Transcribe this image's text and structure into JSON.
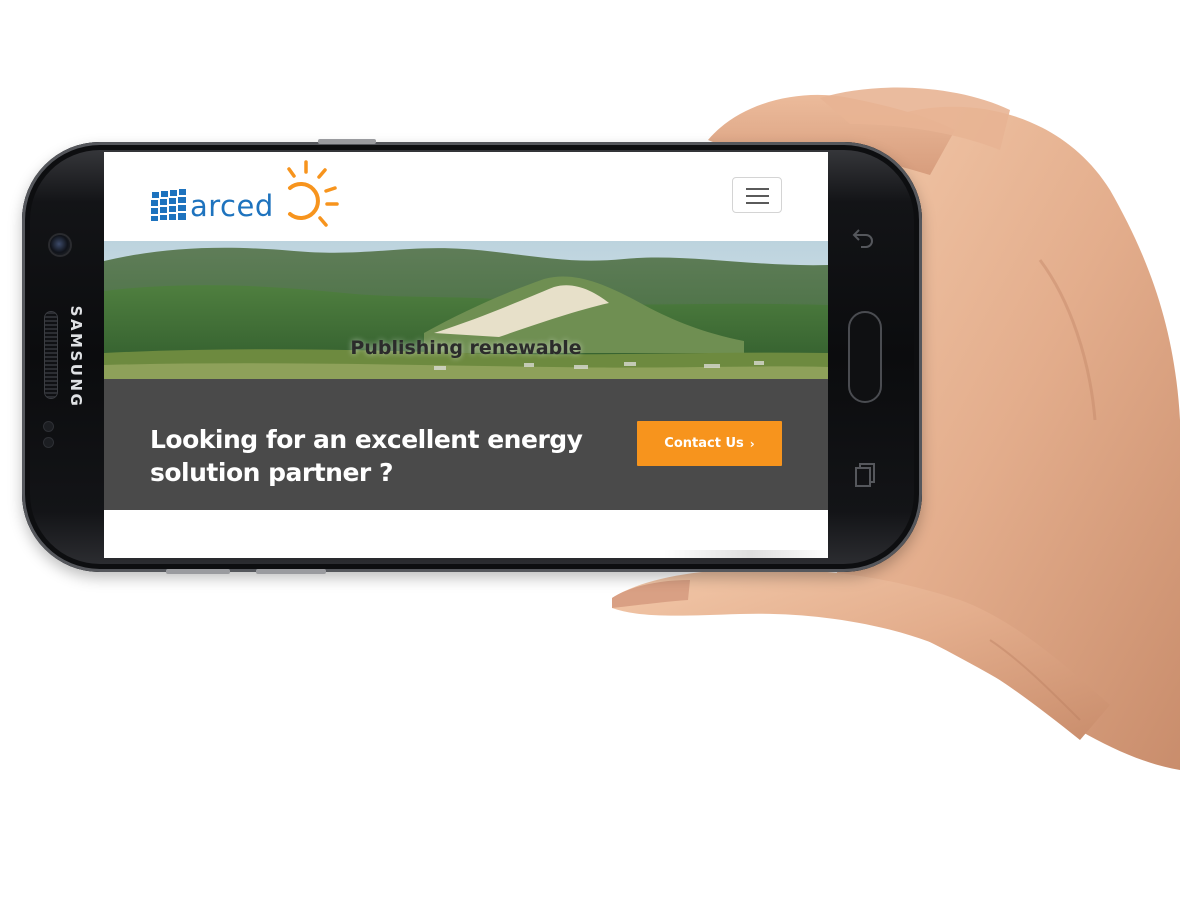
{
  "device": {
    "brand": "SAMSUNG"
  },
  "site": {
    "logo_text": "arced",
    "menu_toggle_label": "Toggle navigation"
  },
  "hero": {
    "caption": "Publishing renewable"
  },
  "cta": {
    "headline": "Looking for an excellent energy solution partner ?",
    "button_label": "Contact Us",
    "button_chevron": "›"
  },
  "colors": {
    "brand_blue": "#1e73be",
    "sun_orange": "#f7941d",
    "cta_background": "#4a4a4a",
    "button_orange": "#f7941d"
  },
  "icons": {
    "menu": "hamburger-icon",
    "logo_panel": "solar-panel-icon",
    "logo_sun": "sun-icon",
    "back": "back-arrow-icon",
    "recents": "recent-apps-icon"
  }
}
